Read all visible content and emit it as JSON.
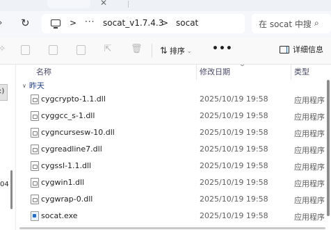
{
  "tabs": {
    "close_glyph": "✕"
  },
  "nav": {
    "back_icon": "back-icon",
    "refresh_icon": "refresh-icon",
    "selected_item_partial": ":)",
    "partial_number": "04"
  },
  "address": {
    "computer_icon": "computer-icon",
    "sep1": ">",
    "ellipsis": "···",
    "crumb1": "socat_v1.7.4.3",
    "sep2": ">",
    "crumb2": "socat"
  },
  "search": {
    "placeholder": "在 socat 中搜",
    "icon": "search-icon"
  },
  "toolbar": {
    "sort_label": "排序",
    "more_label": "•••",
    "details_label": "详细信息"
  },
  "list": {
    "columns": {
      "name": "名称",
      "date": "修改日期",
      "type": "类型"
    },
    "group_label": "昨天",
    "rows": [
      {
        "name": "cygcrypto-1.1.dll",
        "date": "2025/10/19 19:58",
        "type": "应用程序扩展",
        "icon": "dll-file-icon"
      },
      {
        "name": "cyggcc_s-1.dll",
        "date": "2025/10/19 19:58",
        "type": "应用程序扩展",
        "icon": "dll-file-icon"
      },
      {
        "name": "cygncursesw-10.dll",
        "date": "2025/10/19 19:58",
        "type": "应用程序扩展",
        "icon": "dll-file-icon"
      },
      {
        "name": "cygreadline7.dll",
        "date": "2025/10/19 19:58",
        "type": "应用程序扩展",
        "icon": "dll-file-icon"
      },
      {
        "name": "cygssl-1.1.dll",
        "date": "2025/10/19 19:58",
        "type": "应用程序扩展",
        "icon": "dll-file-icon"
      },
      {
        "name": "cygwin1.dll",
        "date": "2025/10/19 19:58",
        "type": "应用程序扩展",
        "icon": "dll-file-icon"
      },
      {
        "name": "cygwrap-0.dll",
        "date": "2025/10/19 19:58",
        "type": "应用程序扩展",
        "icon": "dll-file-icon"
      },
      {
        "name": "socat.exe",
        "date": "2025/10/19 19:58",
        "type": "应用程序",
        "icon": "exe-file-icon"
      }
    ]
  }
}
